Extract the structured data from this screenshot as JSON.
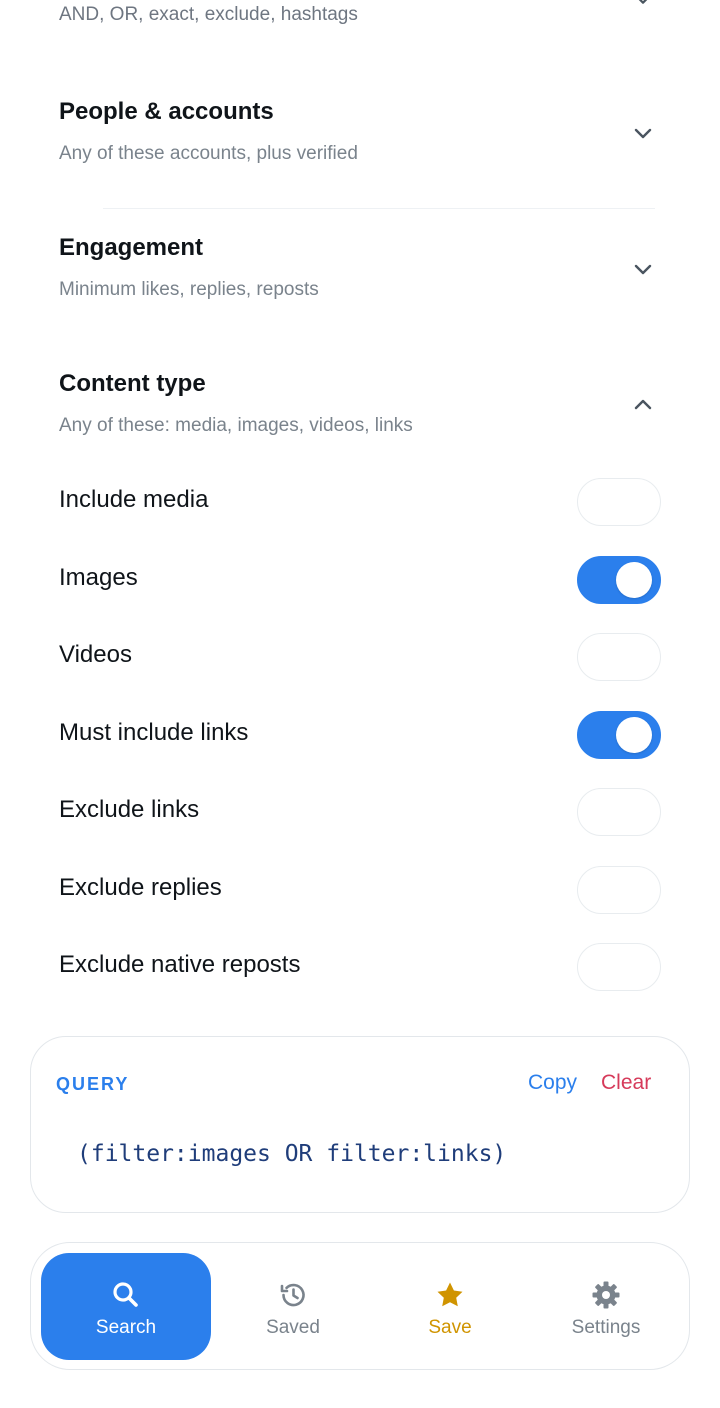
{
  "sections": {
    "keywords": {
      "subtitle": "AND, OR, exact, exclude, hashtags"
    },
    "people": {
      "title": "People & accounts",
      "subtitle": "Any of these accounts, plus verified"
    },
    "engagement": {
      "title": "Engagement",
      "subtitle": "Minimum likes, replies, reposts"
    },
    "content_type": {
      "title": "Content type",
      "subtitle": "Any of these: media, images, videos, links"
    }
  },
  "toggles": [
    {
      "label": "Include media",
      "on": false
    },
    {
      "label": "Images",
      "on": true
    },
    {
      "label": "Videos",
      "on": false
    },
    {
      "label": "Must include links",
      "on": true
    },
    {
      "label": "Exclude links",
      "on": false
    },
    {
      "label": "Exclude replies",
      "on": false
    },
    {
      "label": "Exclude native reposts",
      "on": false
    }
  ],
  "query": {
    "label": "QUERY",
    "copy_label": "Copy",
    "clear_label": "Clear",
    "text": "(filter:images OR filter:links)"
  },
  "nav": {
    "items": [
      {
        "label": "Search",
        "icon": "search-icon",
        "active": true
      },
      {
        "label": "Saved",
        "icon": "history-icon",
        "active": false
      },
      {
        "label": "Save",
        "icon": "star-icon",
        "active": false
      },
      {
        "label": "Settings",
        "icon": "gear-icon",
        "active": false
      }
    ]
  },
  "colors": {
    "accent": "#2b7fec",
    "danger": "#d63a5a",
    "star": "#d09400"
  }
}
